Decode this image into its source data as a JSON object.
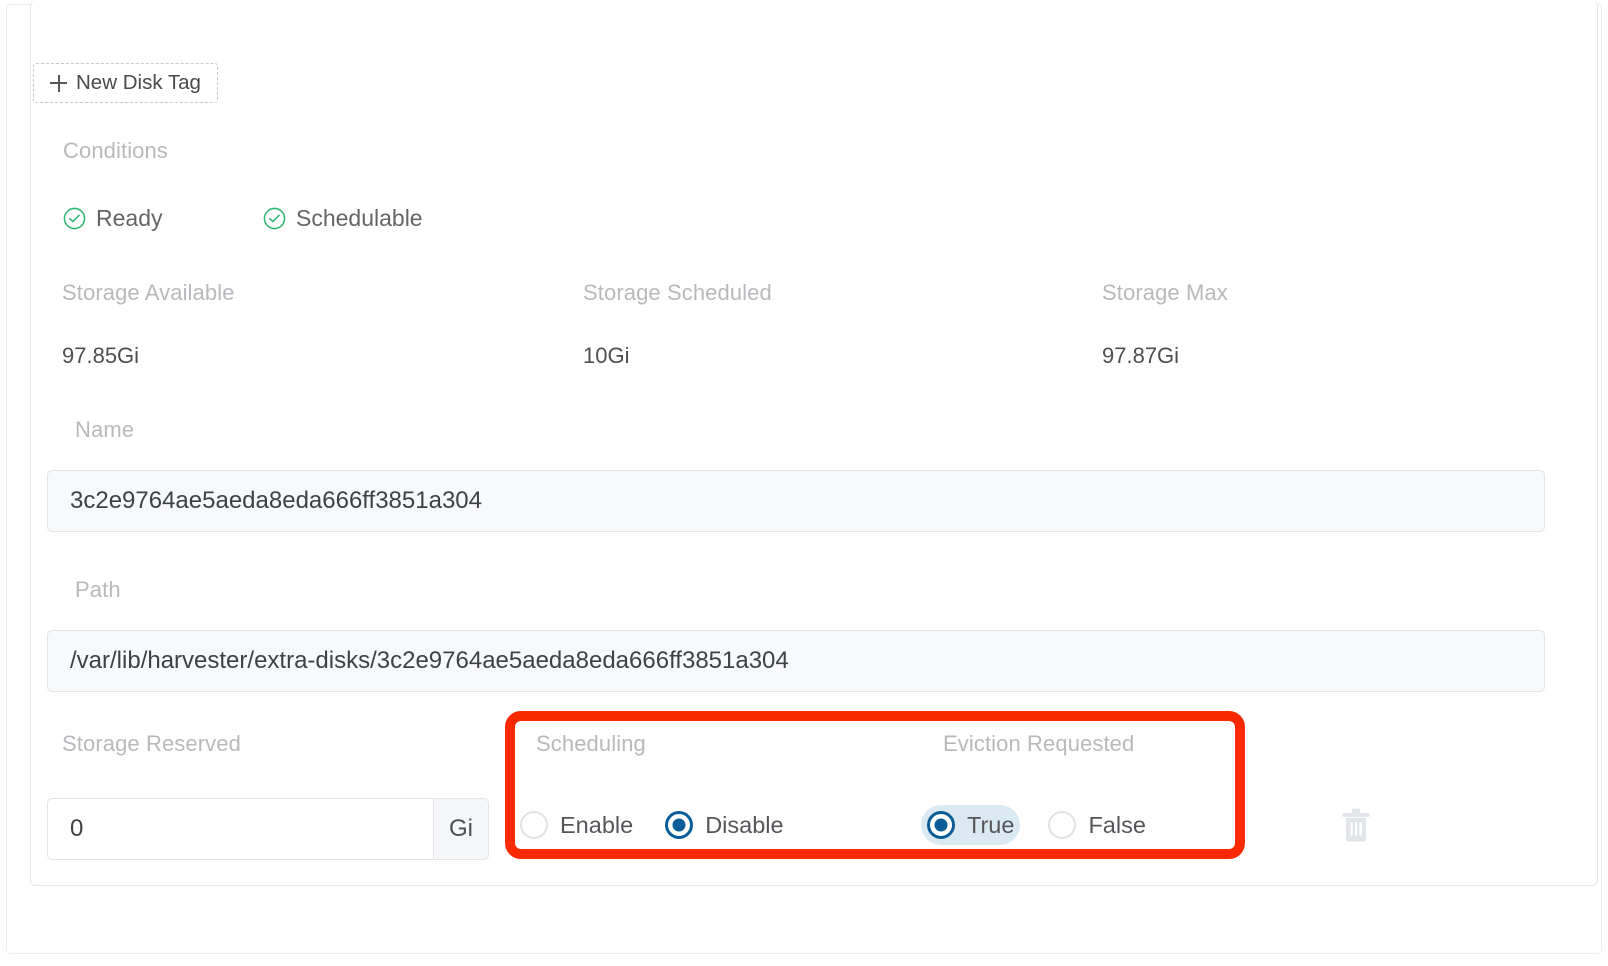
{
  "toolbar": {
    "new_disk_tag_label": "New Disk Tag",
    "plus_icon": "plus-icon"
  },
  "conditions": {
    "section_label": "Conditions",
    "items": [
      {
        "label": "Ready",
        "icon": "check-circle-icon",
        "status_color": "#2bb673"
      },
      {
        "label": "Schedulable",
        "icon": "check-circle-icon",
        "status_color": "#2bb673"
      }
    ]
  },
  "storage_stats": [
    {
      "label": "Storage Available",
      "value": "97.85Gi"
    },
    {
      "label": "Storage Scheduled",
      "value": "10Gi"
    },
    {
      "label": "Storage Max",
      "value": "97.87Gi"
    }
  ],
  "fields": {
    "name": {
      "label": "Name",
      "value": "3c2e9764ae5aeda8eda666ff3851a304"
    },
    "path": {
      "label": "Path",
      "value": "/var/lib/harvester/extra-disks/3c2e9764ae5aeda8eda666ff3851a304"
    },
    "storage_reserved": {
      "label": "Storage Reserved",
      "value": "0",
      "unit": "Gi"
    }
  },
  "scheduling": {
    "label": "Scheduling",
    "options": [
      {
        "label": "Enable",
        "selected": false
      },
      {
        "label": "Disable",
        "selected": true
      }
    ]
  },
  "eviction_requested": {
    "label": "Eviction Requested",
    "options": [
      {
        "label": "True",
        "selected": true,
        "focused": true
      },
      {
        "label": "False",
        "selected": false
      }
    ]
  },
  "actions": {
    "delete_icon": "trash-icon"
  },
  "annotation": {
    "highlight_color": "#fa2a00"
  }
}
